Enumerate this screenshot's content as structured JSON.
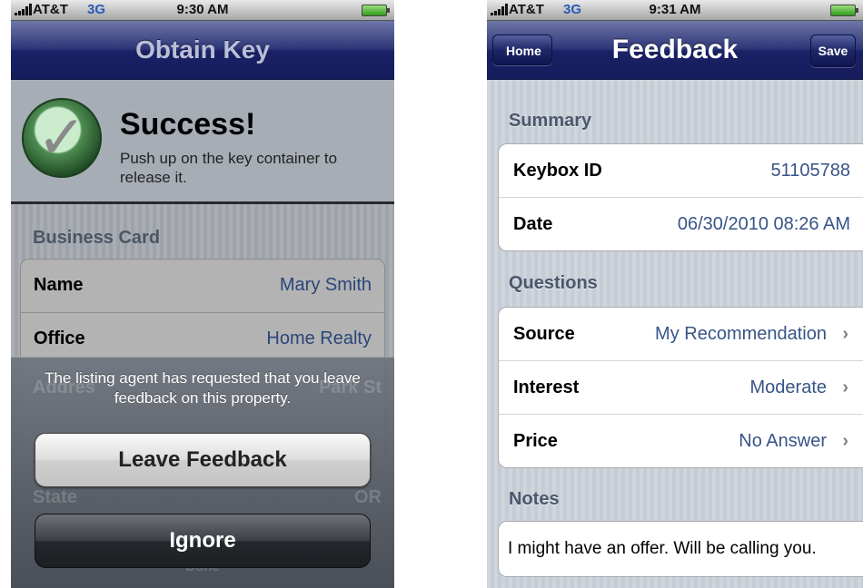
{
  "left_screen": {
    "status": {
      "carrier": "AT&T",
      "network": "3G",
      "time": "9:30 AM"
    },
    "nav_title": "Obtain Key",
    "success": {
      "title": "Success!",
      "message": "Push up on the key container to release it."
    },
    "section_title": "Business Card",
    "card_rows": [
      {
        "label": "Name",
        "value": "Mary Smith"
      },
      {
        "label": "Office",
        "value": "Home Realty"
      }
    ],
    "obscured": {
      "address_partial": "Addres",
      "address_value_partial": "Park St",
      "state_label": "State",
      "state_value": "OR",
      "done_partial": "Done"
    },
    "alert": {
      "message": "The listing agent has requested that you leave feedback on this property.",
      "primary_button": "Leave Feedback",
      "secondary_button": "Ignore"
    }
  },
  "right_screen": {
    "status": {
      "carrier": "AT&T",
      "network": "3G",
      "time": "9:31 AM"
    },
    "nav": {
      "back_button": "Home",
      "title": "Feedback",
      "save_button": "Save"
    },
    "summary_title": "Summary",
    "summary_rows": [
      {
        "label": "Keybox ID",
        "value": "51105788"
      },
      {
        "label": "Date",
        "value": "06/30/2010 08:26 AM"
      }
    ],
    "questions_title": "Questions",
    "question_rows": [
      {
        "label": "Source",
        "value": "My Recommendation"
      },
      {
        "label": "Interest",
        "value": "Moderate"
      },
      {
        "label": "Price",
        "value": "No Answer"
      }
    ],
    "notes_title": "Notes",
    "notes_text": "I might have an offer. Will be calling you."
  },
  "colors": {
    "nav_blue": "#1a2266",
    "value_blue": "#385487",
    "group_bg": "#c5ccd4"
  }
}
